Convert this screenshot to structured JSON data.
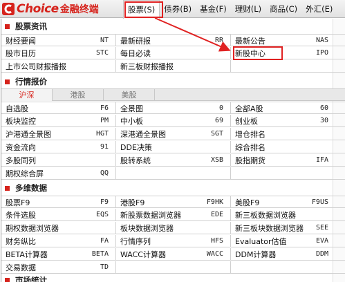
{
  "app": {
    "logo_text": "Choice",
    "logo_cn": "金融终端",
    "brand_color": "#d6231c",
    "highlight_color": "#e02222"
  },
  "menu": [
    {
      "label": "股票(S)",
      "active": true
    },
    {
      "label": "债券(B)",
      "active": false
    },
    {
      "label": "基金(F)",
      "active": false
    },
    {
      "label": "理财(L)",
      "active": false
    },
    {
      "label": "商品(C)",
      "active": false
    },
    {
      "label": "外汇(E)",
      "active": false
    }
  ],
  "sections": {
    "stock_info": "股票资讯",
    "quotes": "行情报价",
    "multi": "多维数据",
    "next": "市场统计"
  },
  "stock_info_rows": [
    [
      {
        "name": "财经要闻",
        "code": "NT"
      },
      {
        "name": "最新研报",
        "code": "RR"
      },
      {
        "name": "最新公告",
        "code": "NAS"
      }
    ],
    [
      {
        "name": "股市日历",
        "code": "STC"
      },
      {
        "name": "每日必读",
        "code": ""
      },
      {
        "name": "新股中心",
        "code": "IPO"
      }
    ],
    [
      {
        "name": "上市公司财报播报",
        "code": ""
      },
      {
        "name": "新三板财报播报",
        "code": ""
      },
      {
        "name": "",
        "code": ""
      }
    ]
  ],
  "quote_tabs": [
    "沪深",
    "港股",
    "美股"
  ],
  "quote_rows": [
    [
      {
        "name": "自选股",
        "code": "F6"
      },
      {
        "name": "全景图",
        "code": "0"
      },
      {
        "name": "全部A股",
        "code": "60"
      }
    ],
    [
      {
        "name": "板块监控",
        "code": "PM"
      },
      {
        "name": "中小板",
        "code": "69"
      },
      {
        "name": "创业板",
        "code": "30"
      }
    ],
    [
      {
        "name": "沪港通全景图",
        "code": "HGT"
      },
      {
        "name": "深港通全景图",
        "code": "SGT"
      },
      {
        "name": "增仓排名",
        "code": ""
      }
    ],
    [
      {
        "name": "资金流向",
        "code": "91"
      },
      {
        "name": "DDE决策",
        "code": ""
      },
      {
        "name": "综合排名",
        "code": ""
      }
    ],
    [
      {
        "name": "多股同列",
        "code": ""
      },
      {
        "name": "股转系统",
        "code": "XSB"
      },
      {
        "name": "股指期货",
        "code": "IFA"
      }
    ],
    [
      {
        "name": "期权综合屏",
        "code": "QQ"
      },
      {
        "name": "",
        "code": ""
      },
      {
        "name": "",
        "code": ""
      }
    ]
  ],
  "multi_rows": [
    [
      {
        "name": "股票F9",
        "code": "F9"
      },
      {
        "name": "港股F9",
        "code": "F9HK"
      },
      {
        "name": "美股F9",
        "code": "F9US"
      }
    ],
    [
      {
        "name": "条件选股",
        "code": "EQS"
      },
      {
        "name": "新股票数据浏览器",
        "code": "EDE"
      },
      {
        "name": "新三板数据浏览器",
        "code": ""
      }
    ],
    [
      {
        "name": "期权数据浏览器",
        "code": ""
      },
      {
        "name": "板块数据浏览器",
        "code": ""
      },
      {
        "name": "新三板块数据浏览器",
        "code": "SEE"
      }
    ],
    [
      {
        "name": "财务纵比",
        "code": "FA"
      },
      {
        "name": "行情序列",
        "code": "HFS"
      },
      {
        "name": "Evaluator估值",
        "code": "EVA"
      }
    ],
    [
      {
        "name": "BETA计算器",
        "code": "BETA"
      },
      {
        "name": "WACC计算器",
        "code": "WACC"
      },
      {
        "name": "DDM计算器",
        "code": "DDM"
      }
    ],
    [
      {
        "name": "交易数据",
        "code": "TD"
      },
      {
        "name": "",
        "code": ""
      },
      {
        "name": "",
        "code": ""
      }
    ]
  ]
}
